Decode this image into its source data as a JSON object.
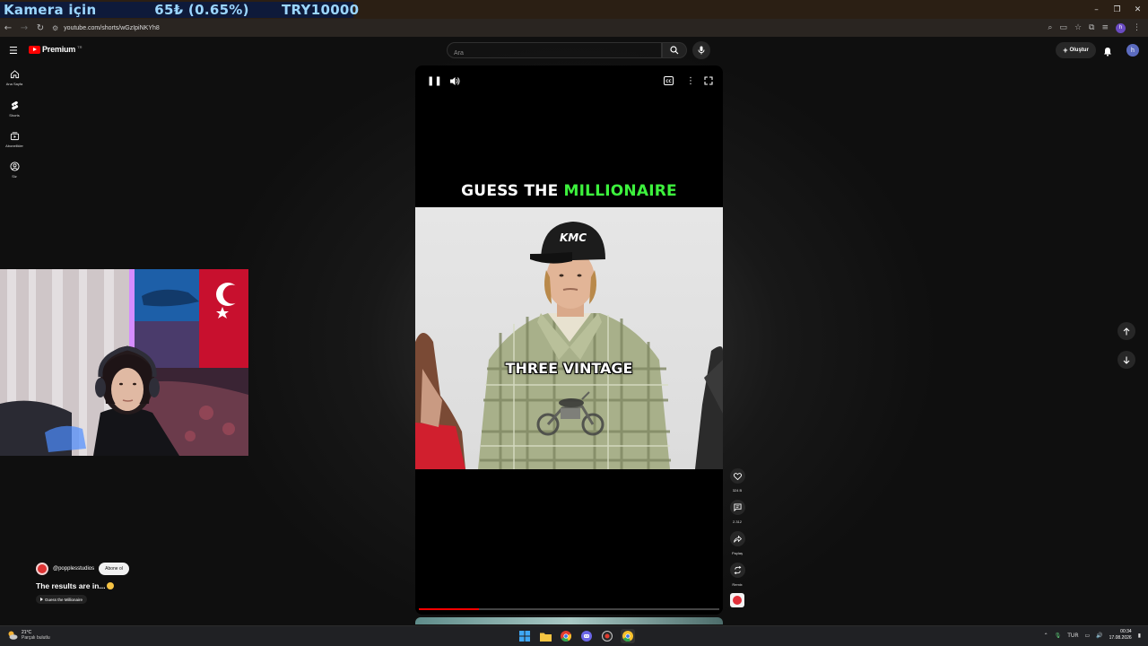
{
  "stream_overlay": {
    "segment1": "Kamera için",
    "segment2": "65₺ (0.65%)",
    "segment3": "TRY10000"
  },
  "window_controls": {
    "minimize": "–",
    "restore": "❐",
    "close": "✕"
  },
  "browser": {
    "url": "youtube.com/shorts/wGzIpiNKYh8"
  },
  "masthead": {
    "logo_text": "Premium",
    "logo_sup": "TR",
    "search_placeholder": "Ara",
    "create_label": "Oluştur",
    "avatar_letter": "h"
  },
  "sidebar": {
    "items": [
      {
        "label": "Ana Sayfa",
        "icon": "home-icon"
      },
      {
        "label": "Shorts",
        "icon": "shorts-icon"
      },
      {
        "label": "Abonelikler",
        "icon": "subscriptions-icon"
      },
      {
        "label": "Siz",
        "icon": "you-icon"
      }
    ]
  },
  "video": {
    "title_part1": "GUESS THE ",
    "title_highlight": "MILLIONAIRE",
    "caption": "THREE VINTAGE",
    "progress_fraction": 0.2
  },
  "actions": {
    "like_count": "324 B",
    "comment_count": "2.312",
    "share_label": "Paylaş",
    "remix_label": "Remix"
  },
  "channel": {
    "handle": "@popplesstudios",
    "subscribe_label": "Abone ol",
    "description": "The results are in...",
    "playlist": "Guess the Millionaire"
  },
  "taskbar": {
    "temperature": "21°C",
    "weather_desc": "Parçalı bulutlu",
    "language": "TUR",
    "time": "00:34",
    "date": "17.08.2026"
  },
  "colors": {
    "youtube_red": "#ff0000",
    "title_highlight": "#3df13d",
    "overlay_text": "#9bd6ff"
  }
}
